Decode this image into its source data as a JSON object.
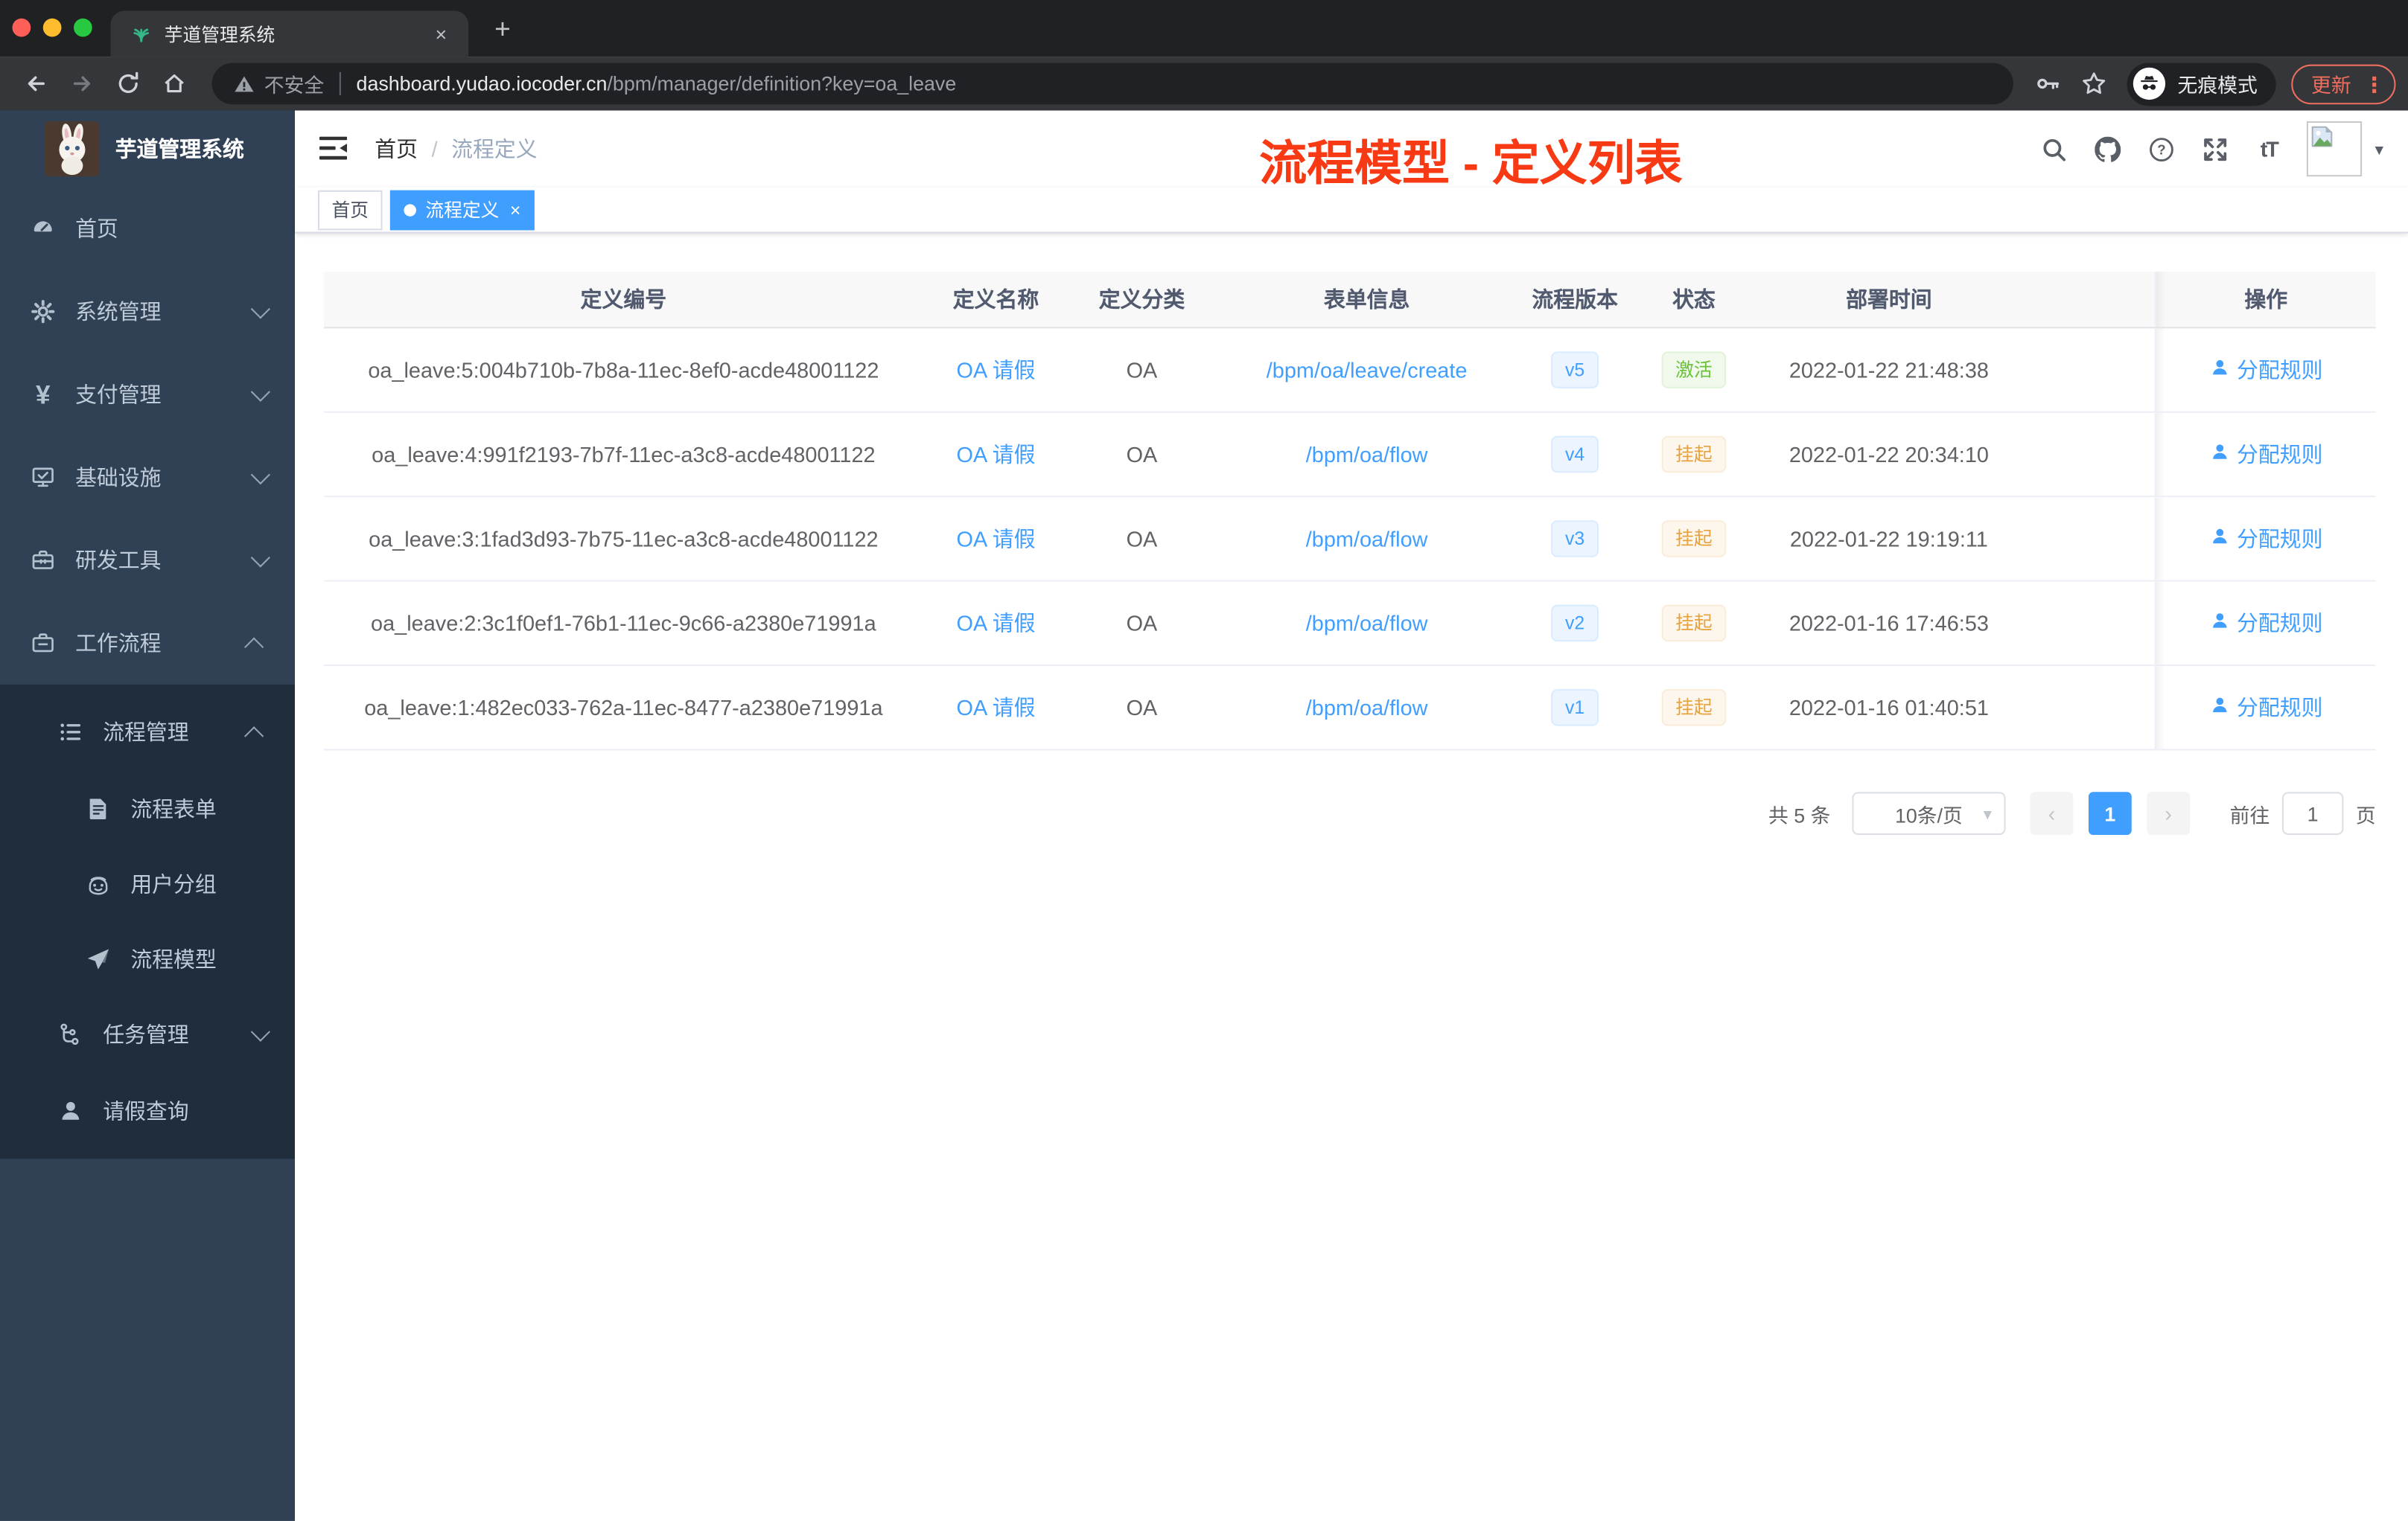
{
  "browser": {
    "tab": {
      "title": "芋道管理系统"
    },
    "address": {
      "security_label": "不安全",
      "host": "dashboard.yudao.iocoder.cn",
      "path": "/bpm/manager/definition?key=oa_leave"
    },
    "incognito_label": "无痕模式",
    "update_label": "更新"
  },
  "icons": {
    "close": "×",
    "plus": "+",
    "more": "⋮",
    "caret_down": "▾",
    "dot": "",
    "yen": "¥",
    "prev": "‹",
    "next": "›",
    "font_size": "tT"
  },
  "sidebar": {
    "title": "芋道管理系统",
    "items": [
      {
        "key": "home",
        "label": "首页",
        "icon": "dashboard-icon",
        "level": 1
      },
      {
        "key": "system-management",
        "label": "系统管理",
        "icon": "gear-icon",
        "level": 1,
        "chevron": "down"
      },
      {
        "key": "payment-management",
        "label": "支付管理",
        "icon": "yen-icon",
        "level": 1,
        "chevron": "down"
      },
      {
        "key": "infrastructure",
        "label": "基础设施",
        "icon": "monitor-icon",
        "level": 1,
        "chevron": "down"
      },
      {
        "key": "dev-tools",
        "label": "研发工具",
        "icon": "toolbox-icon",
        "level": 1,
        "chevron": "down"
      },
      {
        "key": "workflow",
        "label": "工作流程",
        "icon": "briefcase-icon",
        "level": 1,
        "chevron": "up"
      },
      {
        "key": "process-management",
        "label": "流程管理",
        "icon": "list-icon",
        "level": 2,
        "chevron": "up",
        "dark": true
      },
      {
        "key": "process-form",
        "label": "流程表单",
        "icon": "form-doc-icon",
        "level": 3,
        "dark": true
      },
      {
        "key": "user-group",
        "label": "用户分组",
        "icon": "robot-icon",
        "level": 3,
        "dark": true
      },
      {
        "key": "process-model",
        "label": "流程模型",
        "icon": "paper-plane-icon",
        "level": 3,
        "dark": true
      },
      {
        "key": "task-management",
        "label": "任务管理",
        "icon": "tree-icon",
        "level": 2,
        "chevron": "down",
        "dark": true
      },
      {
        "key": "leave-query",
        "label": "请假查询",
        "icon": "user-icon",
        "level": 2,
        "dark": true
      }
    ]
  },
  "navbar": {
    "breadcrumb": {
      "root": "首页",
      "separator": "/",
      "current": "流程定义"
    },
    "annotation": "流程模型 - 定义列表"
  },
  "tags": [
    {
      "label": "首页",
      "active": false
    },
    {
      "label": "流程定义",
      "active": true
    }
  ],
  "table": {
    "columns": [
      "定义编号",
      "定义名称",
      "定义分类",
      "表单信息",
      "流程版本",
      "状态",
      "部署时间",
      "操作"
    ],
    "action_label": "分配规则",
    "rows": [
      {
        "id": "oa_leave:5:004b710b-7b8a-11ec-8ef0-acde48001122",
        "name": "OA 请假",
        "category": "OA",
        "form": "/bpm/oa/leave/create",
        "version": "v5",
        "status": "激活",
        "status_type": "success",
        "deploy_time": "2022-01-22 21:48:38"
      },
      {
        "id": "oa_leave:4:991f2193-7b7f-11ec-a3c8-acde48001122",
        "name": "OA 请假",
        "category": "OA",
        "form": "/bpm/oa/flow",
        "version": "v4",
        "status": "挂起",
        "status_type": "warning",
        "deploy_time": "2022-01-22 20:34:10"
      },
      {
        "id": "oa_leave:3:1fad3d93-7b75-11ec-a3c8-acde48001122",
        "name": "OA 请假",
        "category": "OA",
        "form": "/bpm/oa/flow",
        "version": "v3",
        "status": "挂起",
        "status_type": "warning",
        "deploy_time": "2022-01-22 19:19:11"
      },
      {
        "id": "oa_leave:2:3c1f0ef1-76b1-11ec-9c66-a2380e71991a",
        "name": "OA 请假",
        "category": "OA",
        "form": "/bpm/oa/flow",
        "version": "v2",
        "status": "挂起",
        "status_type": "warning",
        "deploy_time": "2022-01-16 17:46:53"
      },
      {
        "id": "oa_leave:1:482ec033-762a-11ec-8477-a2380e71991a",
        "name": "OA 请假",
        "category": "OA",
        "form": "/bpm/oa/flow",
        "version": "v1",
        "status": "挂起",
        "status_type": "warning",
        "deploy_time": "2022-01-16 01:40:51"
      }
    ]
  },
  "pagination": {
    "total": "共 5 条",
    "page_size": "10条/页",
    "current_page": "1",
    "goto_label": "前往",
    "goto_value": "1",
    "unit_label": "页"
  },
  "colors": {
    "accent_blue": "#409eff",
    "success_green": "#67c23a",
    "warning_orange": "#e6a23c",
    "annotation_red": "#f83a14",
    "sidebar_bg": "#304156",
    "submenu_bg": "#1f2d3d",
    "table_header_bg": "#f8f8f9",
    "chrome_toolbar": "#35363a",
    "update_salmon": "#ee6e5f"
  }
}
